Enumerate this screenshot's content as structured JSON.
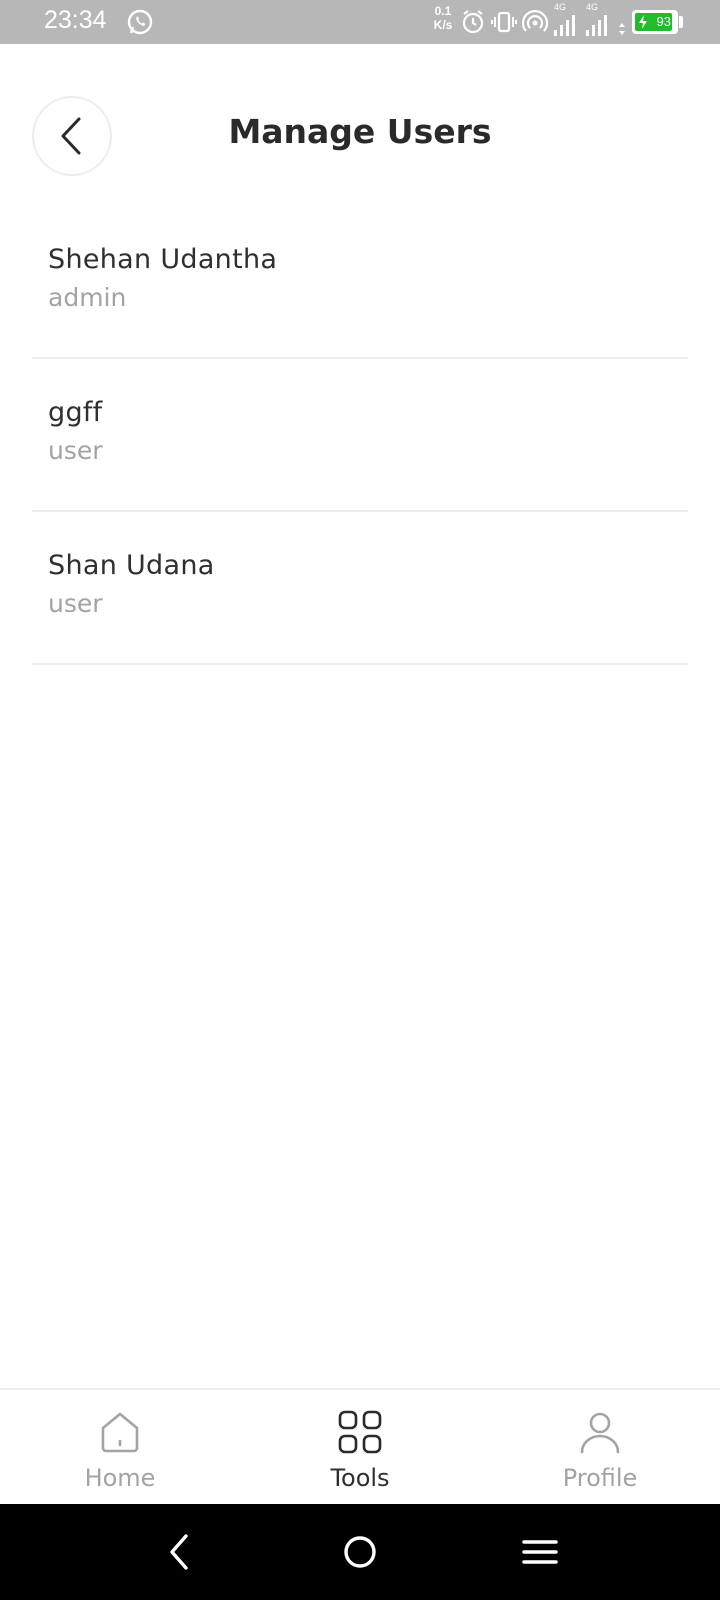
{
  "status_bar": {
    "time": "23:34",
    "net_speed_value": "0.1",
    "net_speed_unit": "K/s",
    "battery_level": "93",
    "battery_fraction": 0.93,
    "icons": [
      "whatsapp-icon",
      "alarm-icon",
      "vibrate-icon",
      "hotspot-icon",
      "signal-4g-icon",
      "signal-4g-icon",
      "battery-charging-icon"
    ],
    "signal_labels": [
      "4G",
      "4G"
    ]
  },
  "header": {
    "back_icon": "chevron-left-icon",
    "title": "Manage Users"
  },
  "users": [
    {
      "name": "Shehan Udantha",
      "role": "admin"
    },
    {
      "name": "ggff",
      "role": "user"
    },
    {
      "name": "Shan Udana",
      "role": "user"
    }
  ],
  "bottom_nav": {
    "items": [
      {
        "label": "Home",
        "icon": "home-icon",
        "active": false
      },
      {
        "label": "Tools",
        "icon": "grid-icon",
        "active": true
      },
      {
        "label": "Profile",
        "icon": "user-icon",
        "active": false
      }
    ]
  },
  "system_nav": {
    "icons": [
      "back-icon",
      "home-circle-icon",
      "menu-icon"
    ]
  },
  "colors": {
    "title": "#2a2a2a",
    "secondary_text": "#a3a3a3",
    "divider": "#ececec",
    "status_bar_bg": "#b7b7b7",
    "battery_green": "#22bb2a"
  }
}
